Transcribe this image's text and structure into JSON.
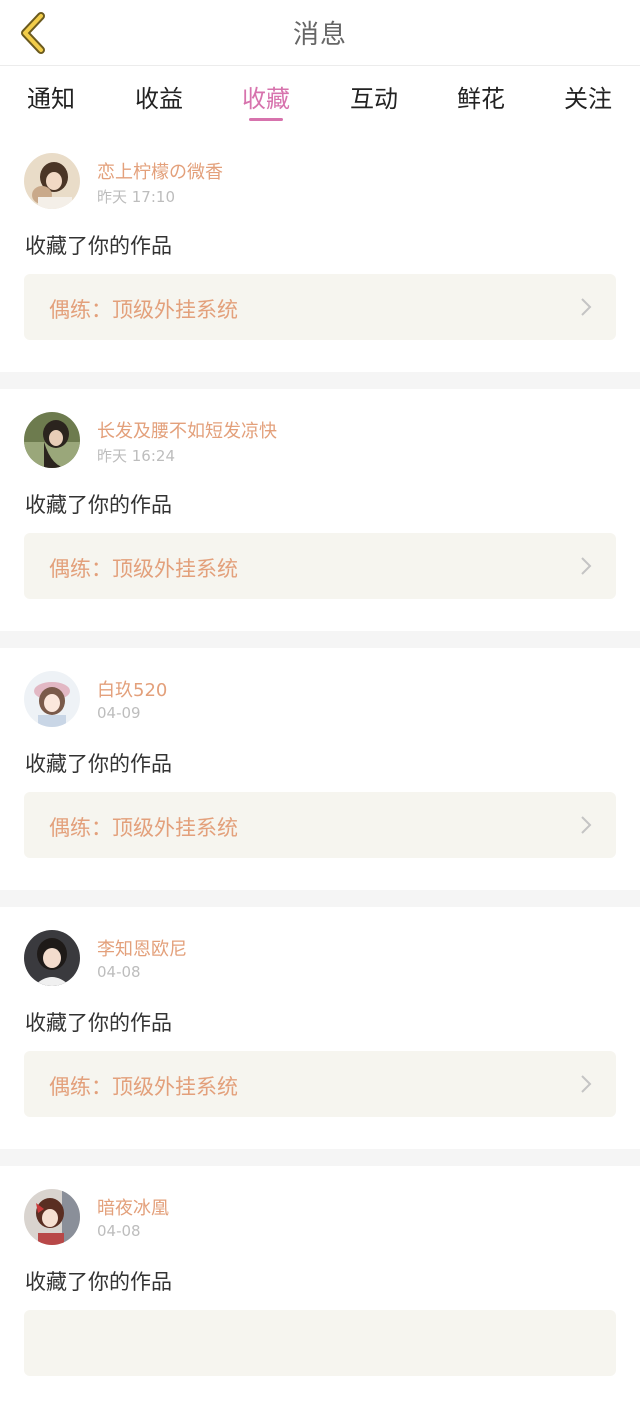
{
  "header": {
    "title": "消息",
    "back_icon": "chevron-left-icon"
  },
  "tabs": [
    {
      "label": "通知",
      "active": false
    },
    {
      "label": "收益",
      "active": false
    },
    {
      "label": "收藏",
      "active": true
    },
    {
      "label": "互动",
      "active": false
    },
    {
      "label": "鲜花",
      "active": false
    },
    {
      "label": "关注",
      "active": false
    }
  ],
  "colors": {
    "accent": "#d773ad",
    "username": "#e3a07b",
    "work_bg": "#f6f5ef"
  },
  "items": [
    {
      "user": "恋上柠檬の微香",
      "time": "昨天 17:10",
      "action": "收藏了你的作品",
      "work": "偶练：顶级外挂系统"
    },
    {
      "user": "长发及腰不如短发凉快",
      "time": "昨天 16:24",
      "action": "收藏了你的作品",
      "work": "偶练：顶级外挂系统"
    },
    {
      "user": "白玖520",
      "time": "04-09",
      "action": "收藏了你的作品",
      "work": "偶练：顶级外挂系统"
    },
    {
      "user": "李知恩欧尼",
      "time": "04-08",
      "action": "收藏了你的作品",
      "work": "偶练：顶级外挂系统"
    },
    {
      "user": "暗夜冰凰",
      "time": "04-08",
      "action": "收藏了你的作品",
      "work": ""
    }
  ]
}
